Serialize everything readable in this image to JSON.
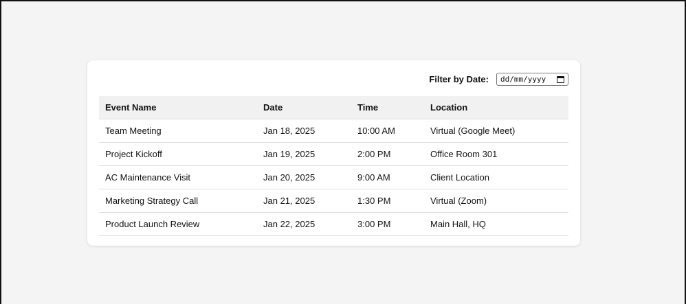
{
  "filter": {
    "label": "Filter by Date:",
    "placeholder": "dd/mm/yyyy"
  },
  "table": {
    "columns": [
      "Event Name",
      "Date",
      "Time",
      "Location"
    ],
    "rows": [
      [
        "Team Meeting",
        "Jan 18, 2025",
        "10:00 AM",
        "Virtual (Google Meet)"
      ],
      [
        "Project Kickoff",
        "Jan 19, 2025",
        "2:00 PM",
        "Office Room 301"
      ],
      [
        "AC Maintenance Visit",
        "Jan 20, 2025",
        "9:00 AM",
        "Client Location"
      ],
      [
        "Marketing Strategy Call",
        "Jan 21, 2025",
        "1:30 PM",
        "Virtual (Zoom)"
      ],
      [
        "Product Launch Review",
        "Jan 22, 2025",
        "3:00 PM",
        "Main Hall, HQ"
      ]
    ]
  },
  "icons": {
    "date_picker": "calendar-icon"
  }
}
